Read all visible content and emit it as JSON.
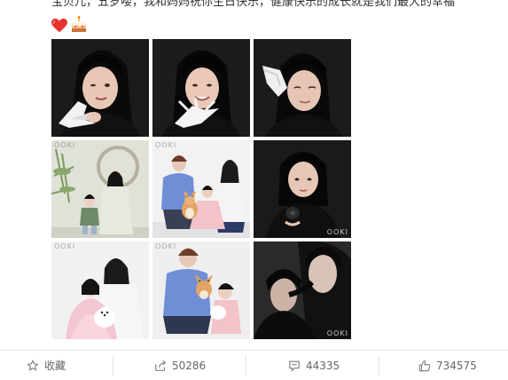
{
  "post": {
    "caption": "宝贝儿，五岁喽，我和妈妈祝你生日快乐，健康快乐的成长就是我们最大的幸福",
    "emojis": [
      "heart-emoji",
      "cake-emoji"
    ],
    "photos": [
      {
        "watermark": ""
      },
      {
        "watermark": ""
      },
      {
        "watermark": ""
      },
      {
        "watermark": "OOKI"
      },
      {
        "watermark": "OOKI"
      },
      {
        "watermark": "OOKI"
      },
      {
        "watermark": "OOKI"
      },
      {
        "watermark": "OOKI"
      },
      {
        "watermark": "OOKI"
      }
    ]
  },
  "actions": {
    "favorite": {
      "label": "收藏",
      "icon": "star-icon"
    },
    "repost": {
      "count": "50286",
      "icon": "share-icon"
    },
    "comment": {
      "count": "44335",
      "icon": "comment-icon"
    },
    "like": {
      "count": "734575",
      "icon": "thumbs-up-icon"
    }
  },
  "colors": {
    "text": "#333333",
    "muted": "#666666",
    "border": "#ececec"
  }
}
